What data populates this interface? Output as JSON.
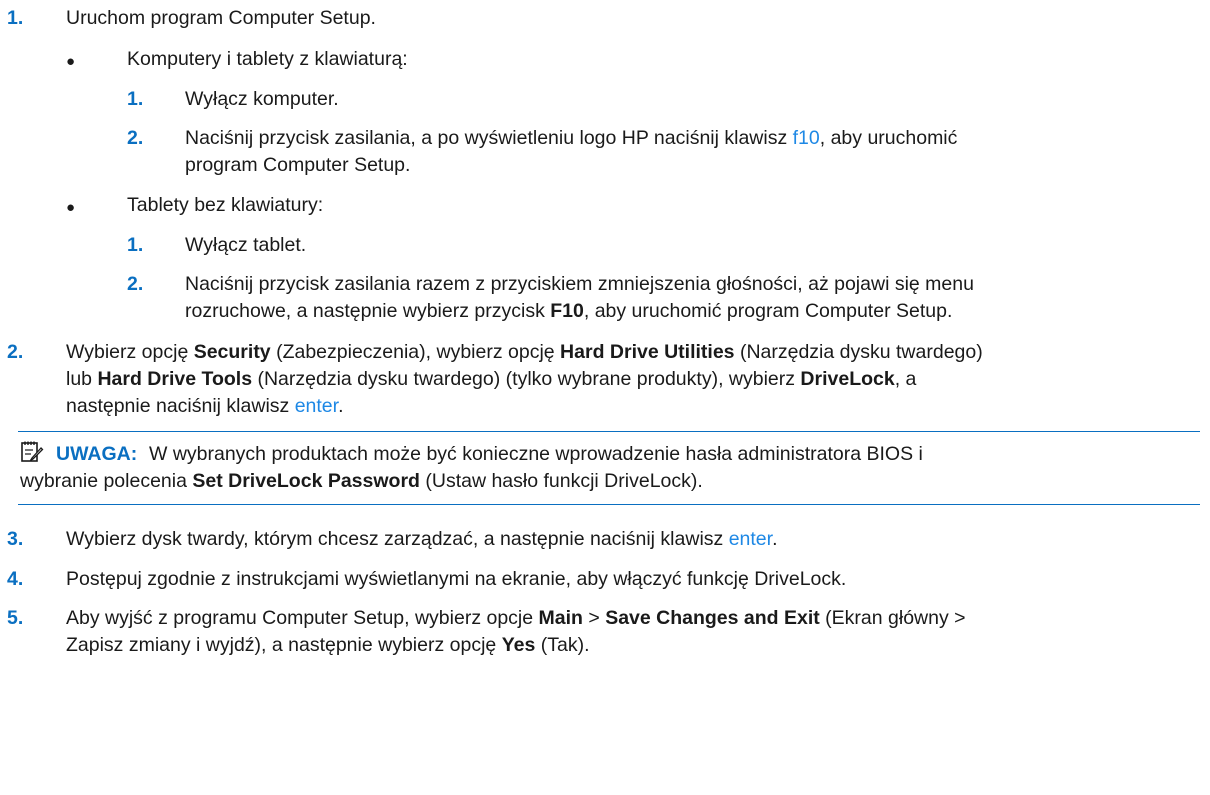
{
  "step1": {
    "num": "1.",
    "text": "Uruchom program Computer Setup.",
    "keyboard": {
      "title": "Komputery i tablety z klawiaturą:",
      "s1_num": "1.",
      "s1_text": "Wyłącz komputer.",
      "s2_num": "2.",
      "s2_a": "Naciśnij przycisk zasilania, a po wyświetleniu logo HP naciśnij klawisz ",
      "s2_key": "f10",
      "s2_b": ", aby uruchomić",
      "s2_c": "program Computer Setup."
    },
    "nokeyboard": {
      "title": "Tablety bez klawiatury:",
      "s1_num": "1.",
      "s1_text": "Wyłącz tablet.",
      "s2_num": "2.",
      "s2_a": "Naciśnij przycisk zasilania razem z przyciskiem zmniejszenia głośności, aż pojawi się menu",
      "s2_b": "rozruchowe, a następnie wybierz przycisk ",
      "s2_key": "F10",
      "s2_c": ", aby uruchomić program Computer Setup."
    }
  },
  "step2": {
    "num": "2.",
    "l1_a": "Wybierz opcję ",
    "l1_b1": "Security",
    "l1_c": " (Zabezpieczenia), wybierz opcję ",
    "l1_b2": "Hard Drive Utilities",
    "l1_d": " (Narzędzia dysku twardego)",
    "l2_a": "lub ",
    "l2_b1": "Hard Drive Tools",
    "l2_c": " (Narzędzia dysku twardego) (tylko wybrane produkty), wybierz ",
    "l2_b2": "DriveLock",
    "l2_d": ", a",
    "l3_a": "następnie naciśnij klawisz ",
    "l3_key": "enter",
    "l3_b": "."
  },
  "note": {
    "label": "UWAGA:",
    "l1": "W wybranych produktach może być konieczne wprowadzenie hasła administratora BIOS i",
    "l2_a": "wybranie polecenia ",
    "l2_b": "Set DriveLock Password",
    "l2_c": " (Ustaw hasło funkcji DriveLock)."
  },
  "step3": {
    "num": "3.",
    "a": "Wybierz dysk twardy, którym chcesz zarządzać, a następnie naciśnij klawisz ",
    "key": "enter",
    "b": "."
  },
  "step4": {
    "num": "4.",
    "text": "Postępuj zgodnie z instrukcjami wyświetlanymi na ekranie, aby włączyć funkcję DriveLock."
  },
  "step5": {
    "num": "5.",
    "l1_a": "Aby wyjść z programu Computer Setup, wybierz opcje ",
    "l1_b1": "Main",
    "l1_c": " > ",
    "l1_b2": "Save Changes and Exit",
    "l1_d": " (Ekran główny >",
    "l2_a": "Zapisz zmiany i wyjdź), a następnie wybierz opcję ",
    "l2_b": "Yes",
    "l2_c": " (Tak)."
  },
  "icons": {
    "bullet": "●",
    "note": "note-icon"
  },
  "colors": {
    "accent": "#0a6fc1",
    "link": "#1e88e5"
  }
}
